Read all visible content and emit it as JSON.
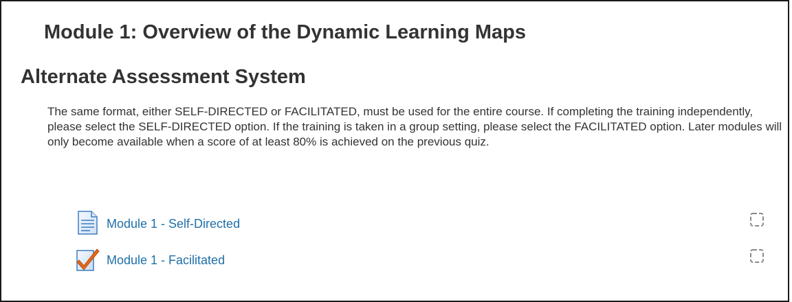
{
  "section": {
    "title_line1": "Module 1: Overview of the Dynamic Learning Maps",
    "title_line2": "Alternate Assessment System",
    "summary": "The same format, either SELF-DIRECTED or FACILITATED, must be used for the entire course. If completing the training independently, please select the SELF-DIRECTED option. If the training is taken in a group setting, please select the FACILITATED option. Later modules will only become available when a score of at least 80% is achieved on the previous quiz."
  },
  "activities": [
    {
      "label": "Module 1 - Self-Directed",
      "icon": "page-icon",
      "completed": false
    },
    {
      "label": "Module 1 - Facilitated",
      "icon": "quiz-checkmark-icon",
      "completed": false
    }
  ],
  "colors": {
    "link": "#1f6fa8",
    "text": "#333333",
    "border": "#1a1a1a",
    "checkmark": "#e06a1b"
  }
}
